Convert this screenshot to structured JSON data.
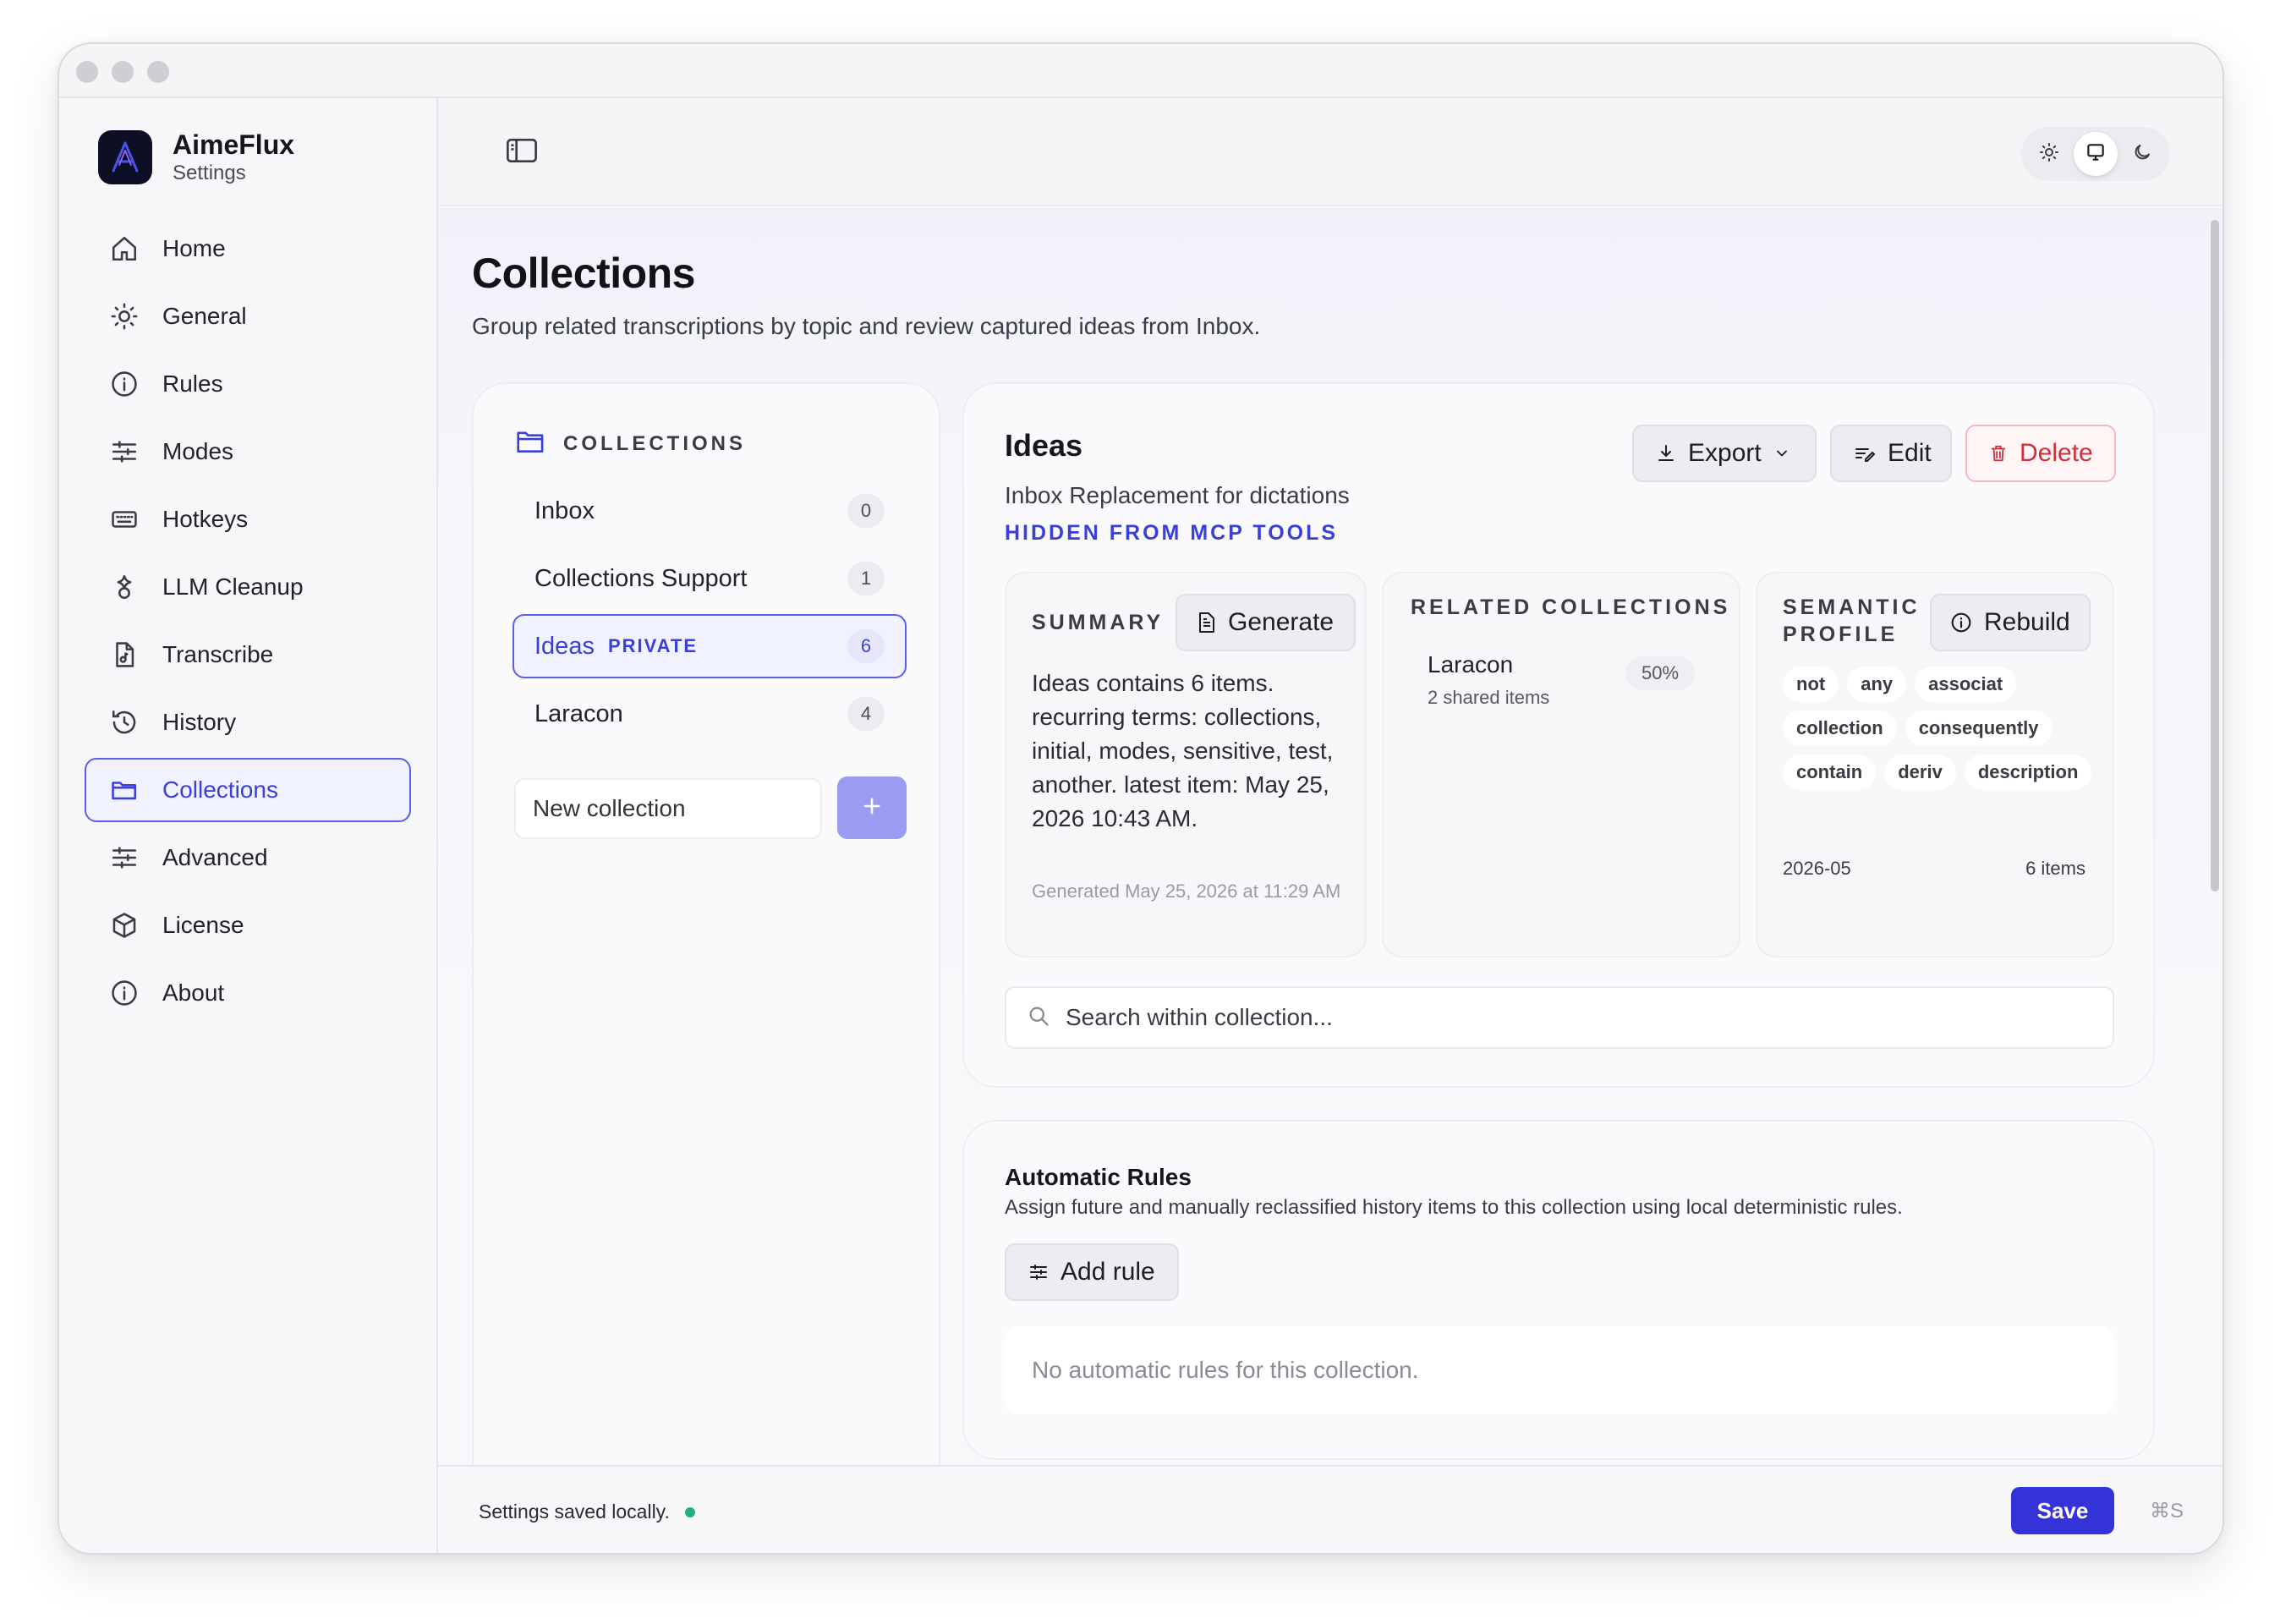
{
  "app": {
    "name": "AimeFlux",
    "subtitle": "Settings"
  },
  "sidebar": {
    "items": [
      {
        "label": "Home",
        "icon": "home-icon"
      },
      {
        "label": "General",
        "icon": "sun-icon"
      },
      {
        "label": "Rules",
        "icon": "info-icon"
      },
      {
        "label": "Modes",
        "icon": "sliders-icon"
      },
      {
        "label": "Hotkeys",
        "icon": "keyboard-icon"
      },
      {
        "label": "LLM Cleanup",
        "icon": "sparkle-icon"
      },
      {
        "label": "Transcribe",
        "icon": "file-audio-icon"
      },
      {
        "label": "History",
        "icon": "history-icon"
      },
      {
        "label": "Collections",
        "icon": "folder-icon",
        "active": true
      },
      {
        "label": "Advanced",
        "icon": "sliders-icon"
      },
      {
        "label": "License",
        "icon": "box-icon"
      },
      {
        "label": "About",
        "icon": "info-icon"
      }
    ]
  },
  "theme": {
    "options": [
      "light",
      "system",
      "dark"
    ],
    "selected": "system"
  },
  "page": {
    "title": "Collections",
    "description": "Group related transcriptions by topic and review captured ideas from Inbox."
  },
  "collections_panel": {
    "heading": "COLLECTIONS",
    "items": [
      {
        "name": "Inbox",
        "count": "0"
      },
      {
        "name": "Collections Support",
        "count": "1"
      },
      {
        "name": "Ideas",
        "tag": "PRIVATE",
        "count": "6",
        "active": true
      },
      {
        "name": "Laracon",
        "count": "4"
      }
    ],
    "new_placeholder": "New collection",
    "add_label": "+"
  },
  "detail": {
    "title": "Ideas",
    "description": "Inbox Replacement for dictations",
    "visibility": "HIDDEN FROM MCP TOOLS",
    "actions": {
      "export": "Export",
      "edit": "Edit",
      "delete": "Delete"
    },
    "summary": {
      "title": "SUMMARY",
      "button": "Generate",
      "text": "Ideas contains 6 items. recurring terms: collections, initial, modes, sensitive, test, another. latest item: May 25, 2026 10:43 AM.",
      "generated": "Generated May 25, 2026 at 11:29 AM"
    },
    "related": {
      "title": "RELATED COLLECTIONS",
      "items": [
        {
          "name": "Laracon",
          "shared": "2 shared items",
          "percent": "50%"
        }
      ]
    },
    "semantic": {
      "title_line1": "SEMANTIC",
      "title_line2": "PROFILE",
      "button": "Rebuild",
      "terms": [
        "not",
        "any",
        "associat",
        "collection",
        "consequently",
        "contain",
        "deriv",
        "description"
      ],
      "period": "2026-05",
      "items": "6 items"
    },
    "search_placeholder": "Search within collection..."
  },
  "rules": {
    "title": "Automatic Rules",
    "description": "Assign future and manually reclassified history items to this collection using local deterministic rules.",
    "add_button": "Add rule",
    "empty": "No automatic rules for this collection."
  },
  "footer": {
    "status": "Settings saved locally.",
    "save": "Save",
    "shortcut": "⌘S"
  },
  "colors": {
    "accent": "#3a3fd8",
    "save": "#3433d8",
    "delete": "#d0303c",
    "status_dot": "#22b07d"
  }
}
